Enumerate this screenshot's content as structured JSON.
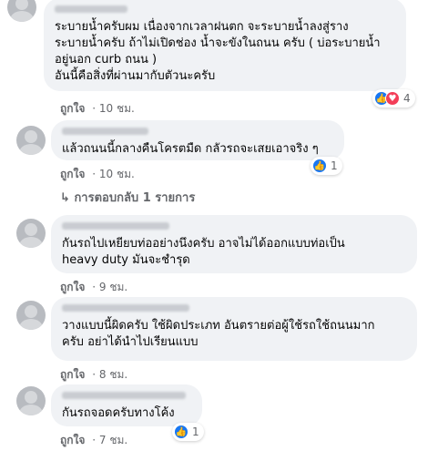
{
  "comments": [
    {
      "lines": [
        "ระบายน้ำครับผม เนื่องจากเวลาฝนตก จะระบายน้ำลงสู่ราง",
        "ระบายน้ำครับ ถ้าไม่เปิดช่อง น้ำจะขังในถนน ครับ ( บ่อระบายน้ำ",
        "อยู่นอก curb ถนน )",
        "อันนี้คือสิ่งที่ผ่านมากับตัวนะครับ"
      ],
      "like_label": "ถูกใจ",
      "time": "10 ชม.",
      "reaction_count": "4"
    },
    {
      "lines": [
        "แล้วถนนนี้กลางคืนโครตมืด กลัวรถจะเสยเอาจริง ๆ"
      ],
      "like_label": "ถูกใจ",
      "time": "10 ชม.",
      "reaction_count": "1",
      "replies_label": "การตอบกลับ 1 รายการ"
    },
    {
      "lines": [
        "กันรถไปเหยียบท่ออย่างนึงครับ อาจไม่ได้ออกแบบท่อเป็น",
        "heavy duty มันจะชำรุด"
      ],
      "like_label": "ถูกใจ",
      "time": "9 ชม."
    },
    {
      "lines": [
        "วางแบบนี้ผิดครับ ใช้ผิดประเภท อันตรายต่อผู้ใช้รถใช้ถนนมาก",
        "ครับ อย่าได้นำไปเรียนแบบ"
      ],
      "like_label": "ถูกใจ",
      "time": "8 ชม."
    },
    {
      "lines": [
        "กันรถจอดครับทางโค้ง"
      ],
      "like_label": "ถูกใจ",
      "time": "7 ชม.",
      "reaction_count": "1"
    }
  ],
  "separator": "·",
  "icons": {
    "like": "thumbs-up-icon",
    "love": "heart-icon",
    "reply_arrow": "reply-arrow-icon"
  },
  "colors": {
    "bubble": "#f0f2f5",
    "meta_text": "#65676b",
    "like_blue": "#1877f2",
    "love_red": "#f33e58"
  }
}
